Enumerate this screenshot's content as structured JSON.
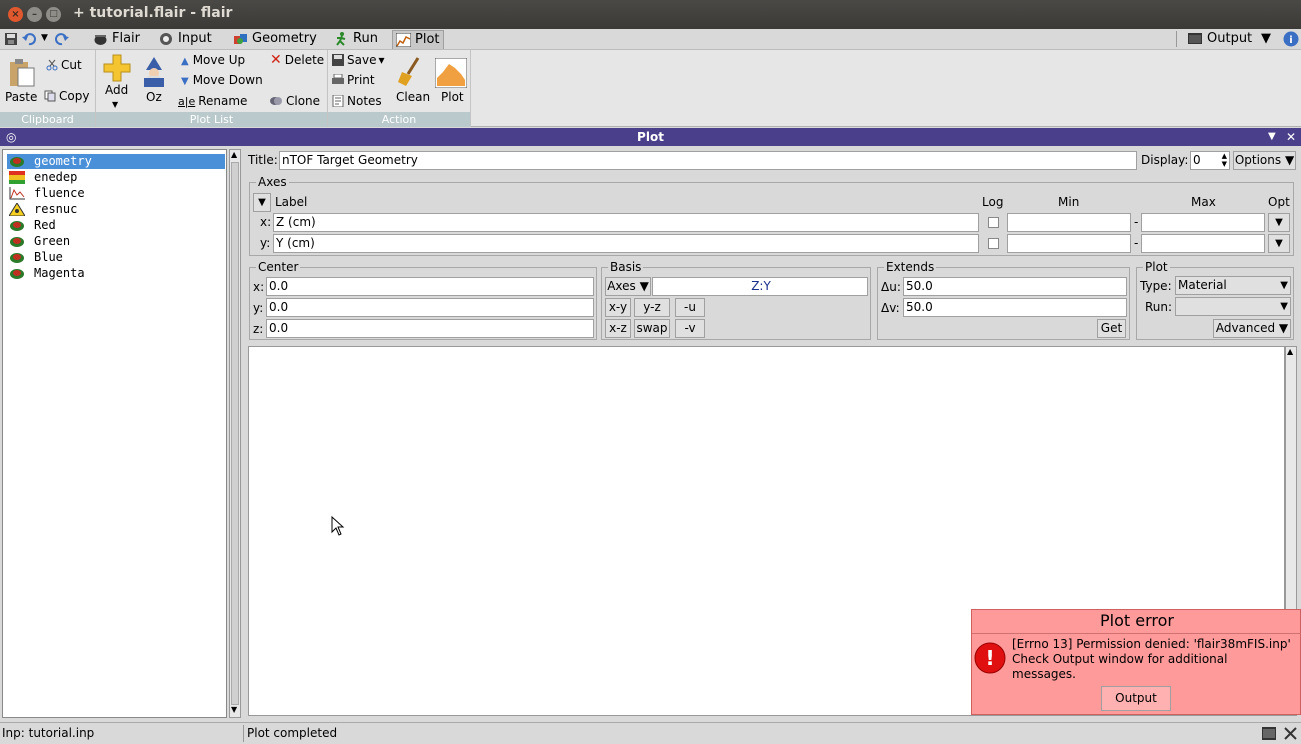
{
  "window": {
    "title": "+ tutorial.flair - flair",
    "close": "×",
    "minimize": "–",
    "maximize": "□"
  },
  "tabs": [
    {
      "label": "Flair"
    },
    {
      "label": "Input"
    },
    {
      "label": "Geometry"
    },
    {
      "label": "Run"
    },
    {
      "label": "Plot"
    }
  ],
  "output_tab": {
    "label": "Output",
    "arrow": "▼"
  },
  "ribbon": {
    "clipboard": {
      "label": "Clipboard",
      "paste": "Paste",
      "cut": "Cut",
      "copy": "Copy"
    },
    "plotlist": {
      "label": "Plot List",
      "add": "Add",
      "add_arrow": "▼",
      "oz": "Oz",
      "move_up": "Move Up",
      "move_down": "Move Down",
      "rename": "Rename",
      "delete": "Delete",
      "clone": "Clone"
    },
    "action": {
      "label": "Action",
      "save": "Save",
      "save_arrow": "▾",
      "print": "Print",
      "notes": "Notes",
      "clean": "Clean",
      "plot": "Plot"
    }
  },
  "panel": {
    "title": "Plot",
    "pin": "◎",
    "collapse": "▼",
    "close": "✕"
  },
  "plot_list": [
    {
      "label": "geometry",
      "icon": "geometry-icon",
      "selected": true
    },
    {
      "label": "enedep",
      "icon": "usrbin-icon",
      "selected": false
    },
    {
      "label": "fluence",
      "icon": "usrbdx-icon",
      "selected": false
    },
    {
      "label": "resnuc",
      "icon": "resnuclei-icon",
      "selected": false
    },
    {
      "label": "Red",
      "icon": "geometry-icon",
      "selected": false
    },
    {
      "label": "Green",
      "icon": "geometry-icon",
      "selected": false
    },
    {
      "label": "Blue",
      "icon": "geometry-icon",
      "selected": false
    },
    {
      "label": "Magenta",
      "icon": "geometry-icon",
      "selected": false
    }
  ],
  "title_row": {
    "label": "Title:",
    "value": "nTOF Target Geometry",
    "display_label": "Display:",
    "display_value": "0",
    "options": "Options ▼"
  },
  "axes": {
    "frame": "Axes",
    "arrow": "▼",
    "hdr_label": "Label",
    "hdr_log": "Log",
    "hdr_min": "Min",
    "hdr_max": "Max",
    "hdr_opt": "Opt",
    "x_label": "x:",
    "x_value": "Z (cm)",
    "y_label": "y:",
    "y_value": "Y (cm)",
    "dash": "-"
  },
  "center": {
    "frame": "Center",
    "x_label": "x:",
    "x": "0.0",
    "y_label": "y:",
    "y": "0.0",
    "z_label": "z:",
    "z": "0.0"
  },
  "basis": {
    "frame": "Basis",
    "axes_btn": "Axes ▼",
    "value": "Z:Y",
    "xy": "x-y",
    "yz": "y-z",
    "mu": "-u",
    "xz": "x-z",
    "swap": "swap",
    "mv": "-v"
  },
  "extends": {
    "frame": "Extends",
    "du_label": "Δu:",
    "du": "50.0",
    "dv_label": "Δv:",
    "dv": "50.0",
    "get": "Get"
  },
  "plot_opts": {
    "frame": "Plot",
    "type_label": "Type:",
    "type": "Material",
    "run_label": "Run:",
    "run": "",
    "advanced": "Advanced ▼",
    "arrow": "▼"
  },
  "error": {
    "title": "Plot error",
    "line1": "[Errno 13] Permission denied: 'flair38mFIS.inp'",
    "line2": "Check Output window for additional",
    "line3": "messages.",
    "button": "Output",
    "icon_glyph": "!"
  },
  "status": {
    "left": "Inp: tutorial.inp",
    "right": "Plot completed"
  },
  "colors": {
    "panel_header": "#4a3f8a",
    "selection": "#4a90d9",
    "error_bg": "#ff9a9a",
    "close_btn": "#e0582e"
  }
}
